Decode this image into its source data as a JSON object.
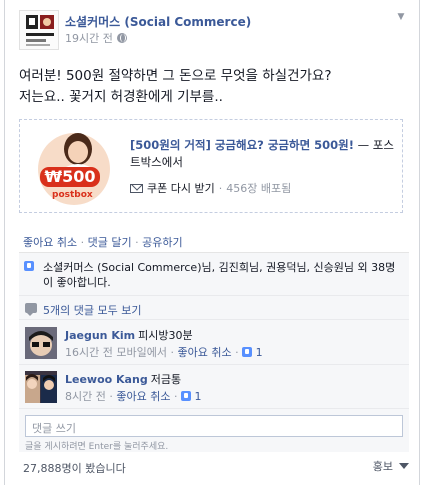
{
  "post": {
    "author": "소셜커머스 (Social Commerce)",
    "timestamp": "19시간 전",
    "text_line1": "여러분! 500원 절약하면 그 돈으로 무엇을 하실건가요?",
    "text_line2": "저는요.. 꽃거지 허경환에게 기부를.."
  },
  "card": {
    "coupon_value": "₩500",
    "coupon_brand": "postbox",
    "title": "[500원의 거적] 궁금해요? 궁금하면 500원!",
    "source": " — 포스트박스에서",
    "action_label": "쿠폰 다시 받기",
    "issued": "456장 배포됨"
  },
  "actions": {
    "unlike": "좋아요 취소",
    "comment": "댓글 달기",
    "share": "공유하기"
  },
  "likes_text": "소셜커머스 (Social Commerce)님, 김진희님, 권용덕님, 신승원님 외 38명이 좋아합니다.",
  "view_all_comments": "5개의 댓글 모두 보기",
  "comments": [
    {
      "name": "Jaegun Kim",
      "text": "피시방30분",
      "time": "16시간 전",
      "via": "모바일에서",
      "unlike": "좋아요 취소",
      "likes": "1"
    },
    {
      "name": "Leewoo Kang",
      "text": "저금통",
      "time": "8시간 전",
      "unlike": "좋아요 취소",
      "likes": "1"
    }
  ],
  "reply": {
    "placeholder": "댓글 쓰기",
    "hint": "글을 게시하려면 Enter를 눌러주세요."
  },
  "footer": {
    "views": "27,888명이 봤습니다",
    "promote": "홍보"
  },
  "colors": {
    "link": "#3b5998",
    "muted": "#9197a3",
    "coupon_red": "#d9301b",
    "ufi_bg": "#f6f7f9"
  }
}
